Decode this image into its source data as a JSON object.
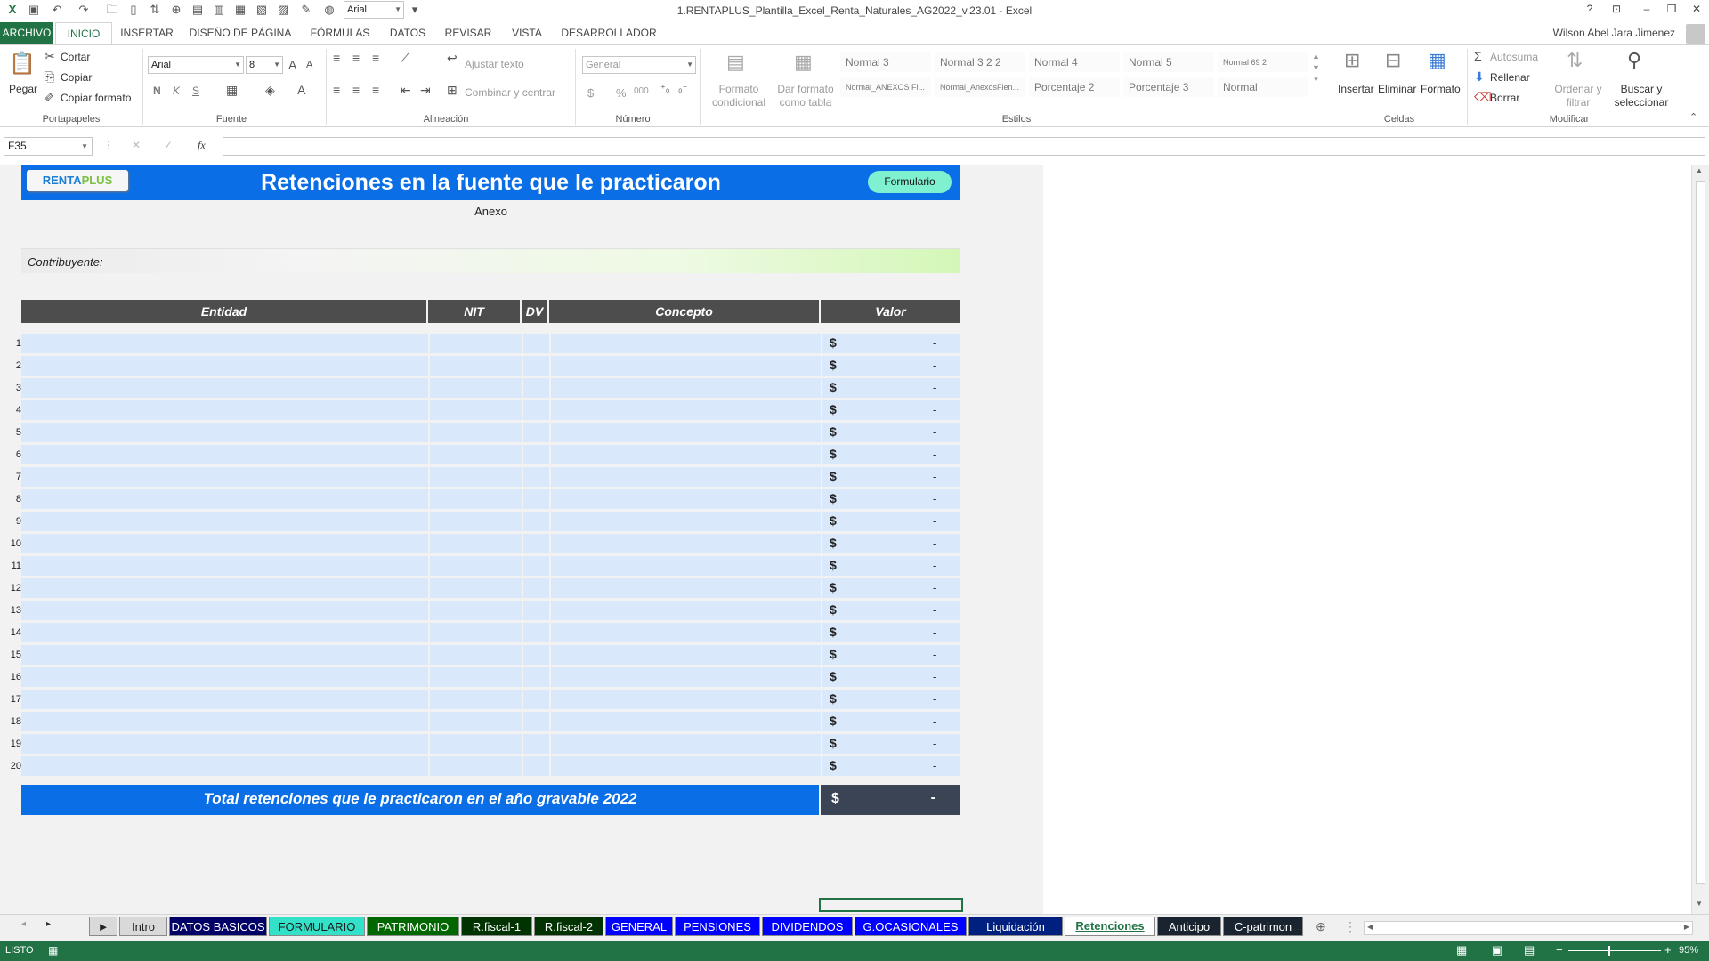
{
  "window": {
    "title": "1.RENTAPLUS_Plantilla_Excel_Renta_Naturales_AG2022_v.23.01 - Excel",
    "font_combo": "Arial",
    "help": "?",
    "user": "Wilson Abel Jara Jimenez"
  },
  "ribbon_tabs": [
    "ARCHIVO",
    "INICIO",
    "INSERTAR",
    "DISEÑO DE PÁGINA",
    "FÓRMULAS",
    "DATOS",
    "REVISAR",
    "VISTA",
    "DESARROLLADOR"
  ],
  "ribbon": {
    "clipboard": {
      "paste": "Pegar",
      "cut": "Cortar",
      "copy": "Copiar",
      "format_painter": "Copiar formato",
      "label": "Portapapeles"
    },
    "font": {
      "name": "Arial",
      "size": "8",
      "bold": "N",
      "italic": "K",
      "underline": "S",
      "label": "Fuente"
    },
    "alignment": {
      "wrap": "Ajustar texto",
      "merge": "Combinar y centrar",
      "label": "Alineación"
    },
    "number": {
      "format": "General",
      "currency": "$",
      "percent": "%",
      "thousands": "000",
      "label": "Número"
    },
    "styles": {
      "conditional": "Formato condicional",
      "as_table": "Dar formato como tabla",
      "cells": [
        "Normal 3",
        "Normal 3 2 2",
        "Normal 4",
        "Normal 5",
        "Normal 69 2",
        "Normal_ANEXOS Fi...",
        "Normal_AnexosFien...",
        "Porcentaje 2",
        "Porcentaje 3",
        "Normal"
      ],
      "label": "Estilos"
    },
    "cells_group": {
      "insert": "Insertar",
      "delete": "Eliminar",
      "format": "Formato",
      "label": "Celdas"
    },
    "editing": {
      "autosum": "Autosuma",
      "fill": "Rellenar",
      "clear": "Borrar",
      "sort": "Ordenar y filtrar",
      "find": "Buscar y seleccionar",
      "label": "Modificar"
    }
  },
  "formula_bar": {
    "name_box": "F35",
    "fx": "fx",
    "value": ""
  },
  "sheet": {
    "logo_main": "RENTA",
    "logo_accent": "PLUS",
    "title": "Retenciones en la fuente que le practicaron",
    "form_button": "Formulario",
    "subtitle": "Anexo",
    "contributor_label": "Contribuyente:",
    "headers": {
      "entity": "Entidad",
      "nit": "NIT",
      "dv": "DV",
      "concept": "Concepto",
      "value": "Valor"
    },
    "rows": [
      {
        "n": "1",
        "currency": "$",
        "value": "-"
      },
      {
        "n": "2",
        "currency": "$",
        "value": "-"
      },
      {
        "n": "3",
        "currency": "$",
        "value": "-"
      },
      {
        "n": "4",
        "currency": "$",
        "value": "-"
      },
      {
        "n": "5",
        "currency": "$",
        "value": "-"
      },
      {
        "n": "6",
        "currency": "$",
        "value": "-"
      },
      {
        "n": "7",
        "currency": "$",
        "value": "-"
      },
      {
        "n": "8",
        "currency": "$",
        "value": "-"
      },
      {
        "n": "9",
        "currency": "$",
        "value": "-"
      },
      {
        "n": "10",
        "currency": "$",
        "value": "-"
      },
      {
        "n": "11",
        "currency": "$",
        "value": "-"
      },
      {
        "n": "12",
        "currency": "$",
        "value": "-"
      },
      {
        "n": "13",
        "currency": "$",
        "value": "-"
      },
      {
        "n": "14",
        "currency": "$",
        "value": "-"
      },
      {
        "n": "15",
        "currency": "$",
        "value": "-"
      },
      {
        "n": "16",
        "currency": "$",
        "value": "-"
      },
      {
        "n": "17",
        "currency": "$",
        "value": "-"
      },
      {
        "n": "18",
        "currency": "$",
        "value": "-"
      },
      {
        "n": "19",
        "currency": "$",
        "value": "-"
      },
      {
        "n": "20",
        "currency": "$",
        "value": "-"
      }
    ],
    "total_label": "Total retenciones que le practicaron en el año gravable 2022",
    "total_currency": "$",
    "total_value": "-"
  },
  "sheet_tabs": [
    {
      "label": "Intro",
      "bg": "#d9d9d9",
      "fg": "#222222"
    },
    {
      "label": "DATOS BASICOS",
      "bg": "#000066",
      "fg": "#ffffff"
    },
    {
      "label": "FORMULARIO",
      "bg": "#33e0c8",
      "fg": "#1a1a1a"
    },
    {
      "label": "PATRIMONIO",
      "bg": "#006600",
      "fg": "#ffffff"
    },
    {
      "label": "R.fiscal-1",
      "bg": "#003300",
      "fg": "#ffffff"
    },
    {
      "label": "R.fiscal-2",
      "bg": "#003300",
      "fg": "#ffffff"
    },
    {
      "label": "GENERAL",
      "bg": "#0000ff",
      "fg": "#ffffff"
    },
    {
      "label": "PENSIONES",
      "bg": "#0000ff",
      "fg": "#ffffff"
    },
    {
      "label": "DIVIDENDOS",
      "bg": "#0000ff",
      "fg": "#ffffff"
    },
    {
      "label": "G.OCASIONALES",
      "bg": "#0000ff",
      "fg": "#ffffff"
    },
    {
      "label": "Liquidación",
      "bg": "#002080",
      "fg": "#ffffff"
    },
    {
      "label": "Retenciones",
      "bg": "#ffffff",
      "fg": "#217346"
    },
    {
      "label": "Anticipo",
      "bg": "#1a2430",
      "fg": "#ffffff"
    },
    {
      "label": "C-patrimon",
      "bg": "#1a2430",
      "fg": "#ffffff"
    }
  ],
  "tab_more": "...",
  "status": {
    "ready": "LISTO",
    "zoom": "95%"
  }
}
